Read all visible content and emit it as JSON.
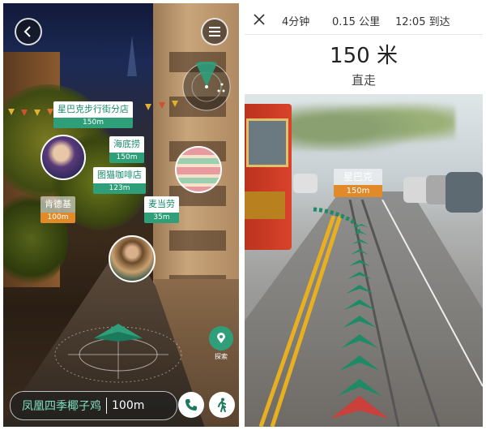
{
  "left_screen": {
    "back_icon": "chevron-left-icon",
    "menu_icon": "hamburger-menu-icon",
    "pois": [
      {
        "name": "星巴克步行街分店",
        "distance": "150m"
      },
      {
        "name": "海底捞",
        "distance": "150m"
      },
      {
        "name": "图猫咖啡店",
        "distance": "123m"
      },
      {
        "name": "肯德基",
        "distance": "100m"
      },
      {
        "name": "麦当劳",
        "distance": "35m"
      }
    ],
    "explore_label": "探索",
    "destination": {
      "name": "凤凰四季椰子鸡",
      "distance": "100m"
    },
    "phone_icon": "phone-icon",
    "walk_icon": "walking-person-icon",
    "colors": {
      "accent": "#2f9f7a",
      "orange": "#e08a2a"
    }
  },
  "right_screen": {
    "close_icon": "close-icon",
    "time": "4分钟",
    "distance": "0.15 公里",
    "arrival": "12:05 到达",
    "next_step_distance": "150 米",
    "instruction": "直走",
    "target": {
      "name": "星巴克",
      "distance": "150m"
    },
    "colors": {
      "arrow": "#1f8a66",
      "start_arrow": "#c9413a"
    }
  }
}
